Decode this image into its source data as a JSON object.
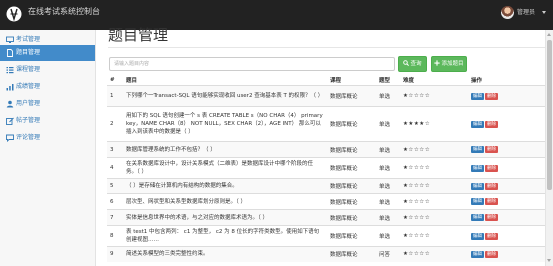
{
  "app": {
    "title": "在线考试系统控制台",
    "user_name": "管理员"
  },
  "sidebar": {
    "items": [
      {
        "label": "考试管理",
        "icon": "monitor-icon",
        "active": false
      },
      {
        "label": "题目管理",
        "icon": "file-icon",
        "active": true
      },
      {
        "label": "课程管理",
        "icon": "list-icon",
        "active": false
      },
      {
        "label": "成绩管理",
        "icon": "signal-icon",
        "active": false
      },
      {
        "label": "用户管理",
        "icon": "user-icon",
        "active": false
      },
      {
        "label": "帖子管理",
        "icon": "edit-icon",
        "active": false
      },
      {
        "label": "评论管理",
        "icon": "comment-icon",
        "active": false
      }
    ]
  },
  "page": {
    "title": "题目管理"
  },
  "search": {
    "placeholder": "请输入题目内容",
    "value": "",
    "search_label": "查询",
    "add_label": "添加题目"
  },
  "table": {
    "headers": [
      "#",
      "题目",
      "课程",
      "题型",
      "难度",
      "操作"
    ],
    "edit_label": "编辑",
    "delete_label": "删除",
    "rows": [
      {
        "id": "1",
        "question": "下列哪个一Transact-SQL 语句能够实现收回 user2 查询基本表 T 的权限？（ ）",
        "course": "数据库概论",
        "type": "单选",
        "stars": "★☆☆☆☆"
      },
      {
        "id": "2",
        "question": "用如下的 SQL 语句创建一个 s 表 CREATE TABLE s（NO CHAR（4） primary key，NAME CHAR（8） NOT NULL，SEX CHAR（2），AGE INT） 那么可以插入到该表中的数据是（ ）",
        "course": "数据库概论",
        "type": "单选",
        "stars": "★★★★☆"
      },
      {
        "id": "3",
        "question": "数据库管理系统的工作不包括？（ ）",
        "course": "数据库概论",
        "type": "单选",
        "stars": "★☆☆☆☆"
      },
      {
        "id": "4",
        "question": "在关系数据库设计中，设计关系模式（二维表）是数据库设计中哪个阶段的任务。（ ）",
        "course": "数据库概论",
        "type": "单选",
        "stars": "★☆☆☆☆"
      },
      {
        "id": "5",
        "question": "（ ）是存储在计算机内有结构的数据的集合。",
        "course": "数据库概论",
        "type": "单选",
        "stars": "★☆☆☆☆"
      },
      {
        "id": "6",
        "question": "层次型、网状型和关系型数据库划分原则是。（ ）",
        "course": "数据库概论",
        "type": "单选",
        "stars": "★☆☆☆☆"
      },
      {
        "id": "7",
        "question": "实体是信息世界中的术语，与之对应的数据库术语为。（ ）",
        "course": "数据库概论",
        "type": "单选",
        "stars": "★☆☆☆☆"
      },
      {
        "id": "8",
        "question": "表 test1 中包含两列： c1 为整型， c2 为 8 位长的字符类数型。使用如下语句创建视图……",
        "course": "数据库概论",
        "type": "单选",
        "stars": "★☆☆☆☆"
      },
      {
        "id": "9",
        "question": "简述关系模型的三类完整性约束。",
        "course": "数据库概论",
        "type": "问答",
        "stars": "★☆☆☆☆"
      }
    ]
  }
}
